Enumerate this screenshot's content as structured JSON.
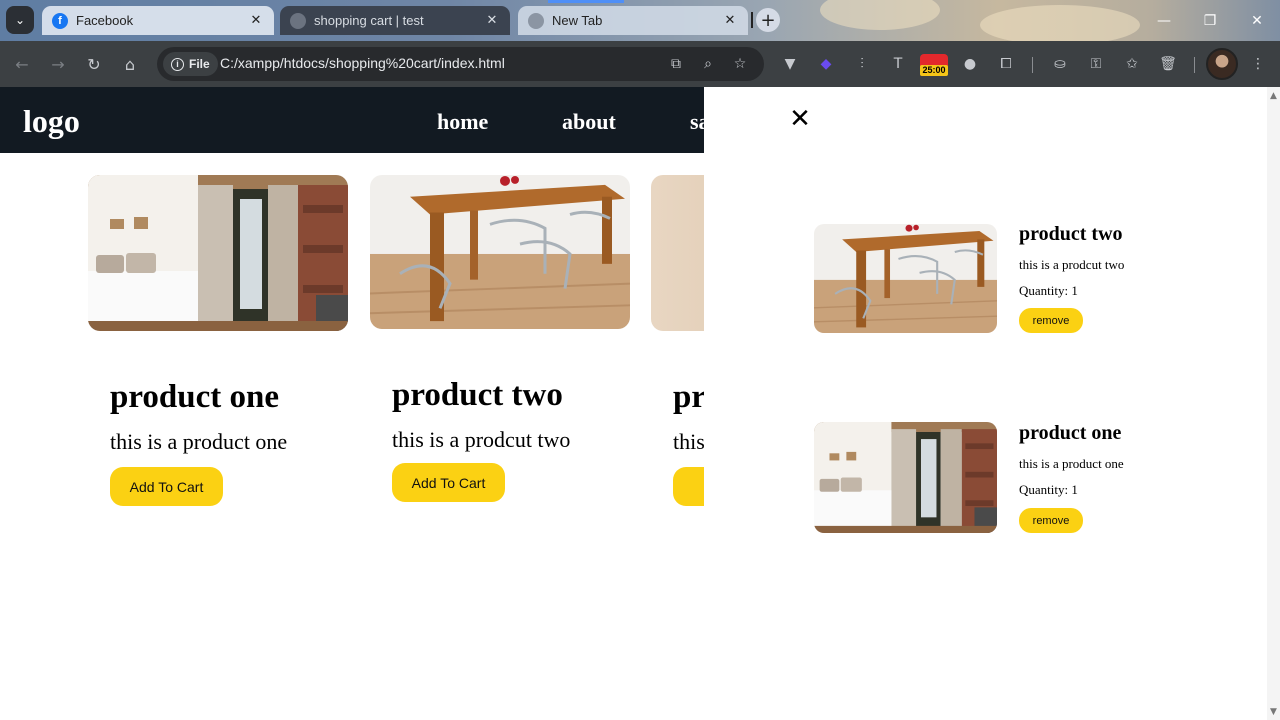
{
  "browser": {
    "tabs": [
      {
        "title": "Facebook",
        "favicon": "facebook-icon",
        "active": false
      },
      {
        "title": "shopping cart | test",
        "favicon": "globe-icon",
        "active": true
      },
      {
        "title": "New Tab",
        "favicon": "globe-icon",
        "active": false
      }
    ],
    "address": {
      "scheme_chip": "File",
      "url": "C:/xampp/htdocs/shopping%20cart/index.html"
    },
    "timer_badge": "25:00",
    "icons": [
      "back-icon",
      "forward-icon",
      "reload-icon",
      "home-icon",
      "translate-icon",
      "zoom-icon",
      "bookmark-star-icon",
      "vivaldi-extension-icon",
      "cube-extension-icon",
      "sliders-extension-icon",
      "t-extension-icon",
      "timer-extension-icon",
      "circle-extension-icon",
      "puzzle-extensions-icon",
      "incognito-icon",
      "password-key-icon",
      "bookmarks-icon",
      "trash-icon",
      "profile-avatar",
      "menu-kebab-icon"
    ]
  },
  "site": {
    "logo": "logo",
    "nav": [
      "home",
      "about",
      "sa"
    ]
  },
  "products": [
    {
      "title": "product one",
      "description": "this is a product one",
      "button": "Add To Cart",
      "image": "bedroom-photo"
    },
    {
      "title": "product two",
      "description": "this is a prodcut two",
      "button": "Add To Cart",
      "image": "dining-table-photo"
    },
    {
      "title": "pr",
      "description": "this",
      "button": "A",
      "image": "partial-photo"
    }
  ],
  "cart": {
    "close_label": "✕",
    "items": [
      {
        "title": "product two",
        "description": "this is a prodcut two",
        "quantity": "Quantity: 1",
        "remove": "remove",
        "image": "dining-table-photo"
      },
      {
        "title": "product one",
        "description": "this is a product one",
        "quantity": "Quantity: 1",
        "remove": "remove",
        "image": "bedroom-photo"
      }
    ]
  },
  "colors": {
    "header_bg": "#121a22",
    "button_yellow": "#fbd113",
    "toolbar": "#3c4043"
  }
}
